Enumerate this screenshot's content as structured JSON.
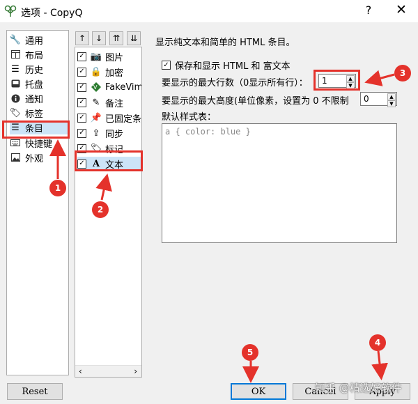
{
  "window": {
    "title": "选项 - CopyQ",
    "help_label": "?",
    "close_label": "✕"
  },
  "nav": {
    "items": [
      {
        "label": "通用",
        "icon": "wrench-icon"
      },
      {
        "label": "布局",
        "icon": "layout-icon"
      },
      {
        "label": "历史",
        "icon": "list-icon"
      },
      {
        "label": "托盘",
        "icon": "inbox-icon"
      },
      {
        "label": "通知",
        "icon": "info-icon"
      },
      {
        "label": "标签",
        "icon": "tags-icon"
      },
      {
        "label": "条目",
        "icon": "list-icon"
      },
      {
        "label": "快捷键",
        "icon": "keyboard-icon"
      },
      {
        "label": "外观",
        "icon": "image-icon"
      }
    ],
    "selected": "条目"
  },
  "tab_toolbar": [
    "↑",
    "↓",
    "⇈",
    "⇊"
  ],
  "item_tabs": {
    "items": [
      {
        "label": "图片",
        "checked": true,
        "icon": "camera-icon"
      },
      {
        "label": "加密",
        "checked": true,
        "icon": "lock-icon"
      },
      {
        "label": "FakeVim",
        "checked": true,
        "icon": "vim-icon"
      },
      {
        "label": "备注",
        "checked": true,
        "icon": "note-icon"
      },
      {
        "label": "已固定条",
        "checked": true,
        "icon": "pin-icon"
      },
      {
        "label": "同步",
        "checked": true,
        "icon": "upload-icon"
      },
      {
        "label": "标记",
        "checked": true,
        "icon": "tag-icon"
      },
      {
        "label": "文本",
        "checked": true,
        "icon": "text-icon"
      }
    ],
    "selected": "文本"
  },
  "text_settings": {
    "description": "显示纯文本和简单的 HTML 条目。",
    "save_html_label": "保存和显示 HTML 和 富文本",
    "save_html_checked": true,
    "max_lines_label": "要显示的最大行数（0显示所有行）：",
    "max_lines_value": "1",
    "max_height_label": "要显示的最大高度(单位像素，设置为 0 不限制",
    "max_height_value": "0",
    "stylesheet_label": "默认样式表：",
    "stylesheet_placeholder": "a { color: blue }"
  },
  "buttons": {
    "reset": "Reset",
    "ok": "OK",
    "cancel": "Cancel",
    "apply": "Apply"
  },
  "annotations": [
    "1",
    "2",
    "3",
    "4",
    "5"
  ],
  "watermark": "知乎 @精选好软件",
  "colors": {
    "annotation": "#e4322b",
    "selection": "#cce4f7",
    "default_button_border": "#0078d7"
  }
}
